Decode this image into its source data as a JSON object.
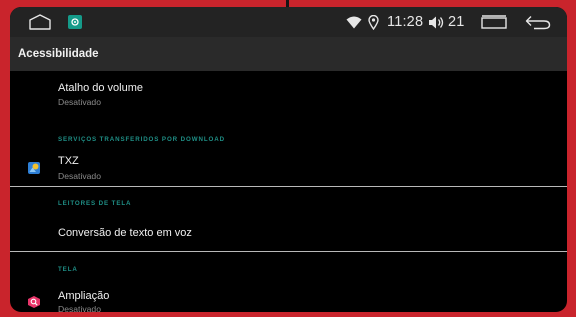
{
  "status_bar": {
    "time": "11:28",
    "volume_level": "21"
  },
  "app_bar": {
    "title": "Acessibilidade"
  },
  "list": {
    "volume_shortcut": {
      "title": "Atalho do volume",
      "subtitle": "Desativado"
    },
    "downloaded_services_header": "SERVIÇOS TRANSFERIDOS POR DOWNLOAD",
    "txz": {
      "title": "TXZ",
      "subtitle": "Desativado"
    },
    "screen_readers_header": "LEITORES DE TELA",
    "tts": {
      "title": "Conversão de texto em voz"
    },
    "display_header": "TELA",
    "magnification": {
      "title": "Ampliação",
      "subtitle": "Desativado"
    }
  },
  "colors": {
    "frame": "#c9242c",
    "status_bar": "#232323",
    "app_bar": "#2a2a2a",
    "section_header": "#1f8f86",
    "settings_badge": "#159b8a",
    "magnify_icon": "#e8356a"
  }
}
